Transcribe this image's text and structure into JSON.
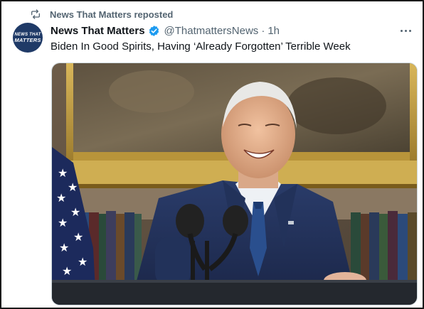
{
  "repost": {
    "label": "News That Matters reposted",
    "icon": "repost-icon"
  },
  "author": {
    "avatar_text_line1": "NEWS THAT",
    "avatar_text_line2": "MATTERS",
    "avatar_color": "#1f3a67",
    "display_name": "News That Matters",
    "verified_color": "#1d9bf0",
    "handle": "@ThatmattersNews",
    "separator": "·",
    "time": "1h"
  },
  "tweet": {
    "text": "Biden In Good Spirits, Having ‘Already Forgotten’ Terrible Week"
  },
  "media": {
    "alt_icon": "photo-image"
  }
}
